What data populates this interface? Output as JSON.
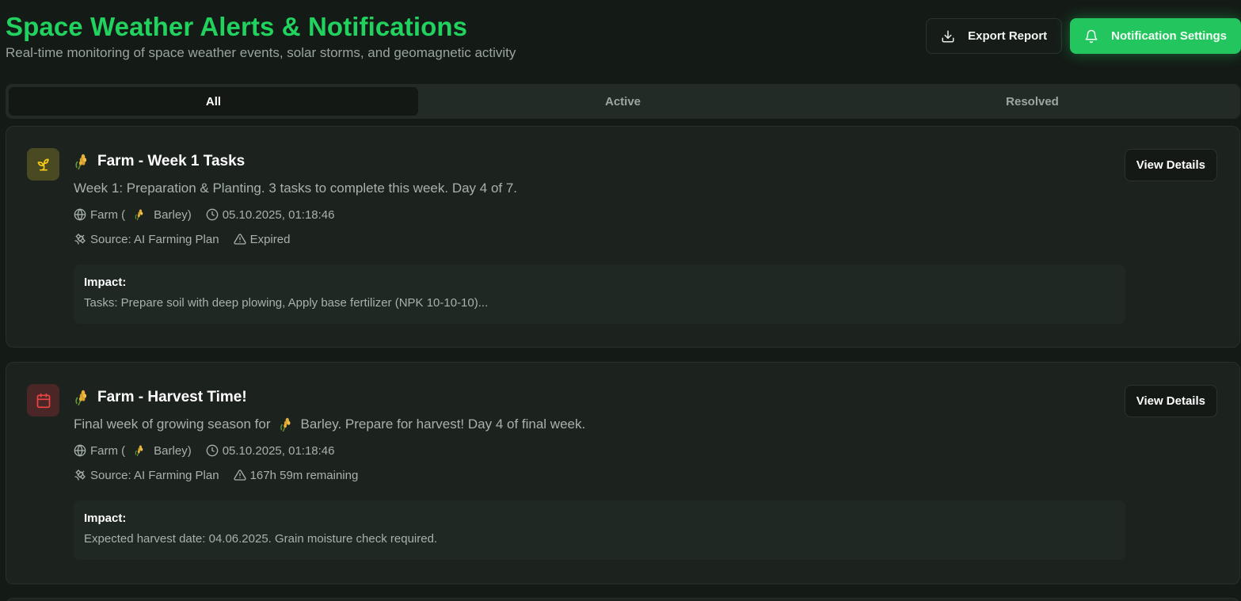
{
  "header": {
    "title": "Space Weather Alerts & Notifications",
    "subtitle": "Real-time monitoring of space weather events, solar storms, and geomagnetic activity",
    "export_label": "Export Report",
    "settings_label": "Notification Settings"
  },
  "tabs": [
    {
      "label": "All",
      "active": true
    },
    {
      "label": "Active",
      "active": false
    },
    {
      "label": "Resolved",
      "active": false
    }
  ],
  "alerts": [
    {
      "icon": "sprout-icon",
      "title": "Farm - Week 1 Tasks",
      "description": "Week 1: Preparation & Planting. 3 tasks to complete this week. Day 4 of 7.",
      "location_prefix": "Farm (",
      "location_crop": "Barley)",
      "timestamp": "05.10.2025, 01:18:46",
      "source": "Source: AI Farming Plan",
      "status": "Expired",
      "impact_label": "Impact:",
      "impact_text": "Tasks: Prepare soil with deep plowing, Apply base fertilizer (NPK 10-10-10)...",
      "button_label": "View Details"
    },
    {
      "icon": "calendar-icon",
      "title": "Farm - Harvest Time!",
      "description_prefix": "Final week of growing season for",
      "description_suffix": "Barley. Prepare for harvest! Day 4 of final week.",
      "location_prefix": "Farm (",
      "location_crop": "Barley)",
      "timestamp": "05.10.2025, 01:18:46",
      "source": "Source: AI Farming Plan",
      "status": "167h 59m remaining",
      "impact_label": "Impact:",
      "impact_text": "Expected harvest date: 04.06.2025. Grain moisture check required.",
      "button_label": "View Details"
    }
  ],
  "colors": {
    "accent": "#22c55e",
    "title": "#22d25f",
    "background": "#141a16",
    "card": "#1c231f"
  }
}
